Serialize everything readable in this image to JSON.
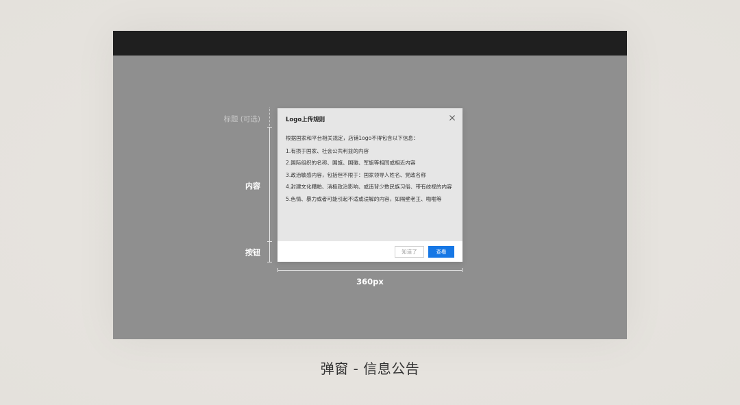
{
  "annotations": {
    "title_label": "标题 (可选)",
    "content_label": "内容",
    "button_label": "按钮",
    "width_label": "360px"
  },
  "dialog": {
    "title": "Logo上传规则",
    "close_icon": "close-icon",
    "intro": "根据国家和平台相关规定，店铺1ogo不得包含以下信息：",
    "rules": [
      "1.有损于国家、社会公共利益的内容",
      "2.国际组织的名称、国旗、国徽、军旗等相同或相近内容",
      "3.政治敏感内容，包括但不限于：国家领导人姓名、党政名称",
      "4.封建文化糟粕、消极政治影响、或违背少数民族习俗、带有歧视的内容",
      "5.色情、暴力或者可能引起不适或误解的内容，如隔壁老王、啪啪等"
    ],
    "buttons": {
      "secondary": "知道了",
      "primary": "查看"
    }
  },
  "caption": "弹窗 - 信息公告",
  "colors": {
    "primary": "#1677e5",
    "overlay": "#8f8f8f",
    "topbar": "#1f1f1f"
  }
}
